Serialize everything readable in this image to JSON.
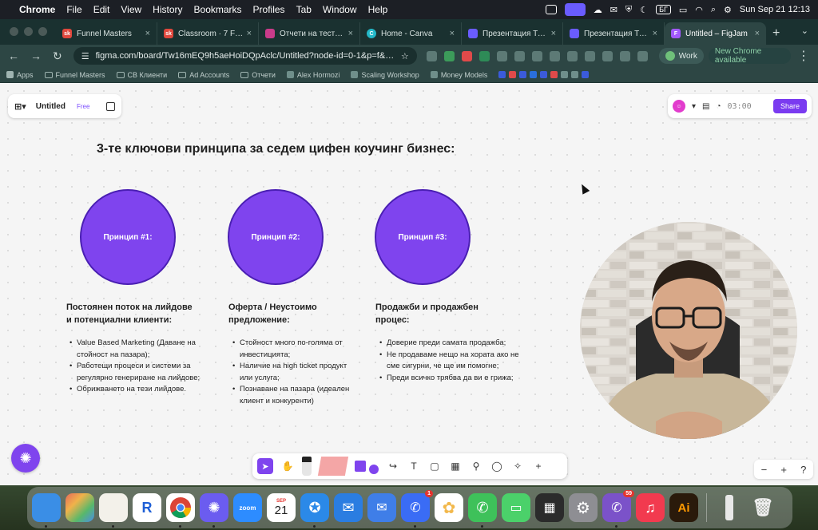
{
  "menubar": {
    "app": "Chrome",
    "items": [
      "File",
      "Edit",
      "View",
      "History",
      "Bookmarks",
      "Profiles",
      "Tab",
      "Window",
      "Help"
    ],
    "keyboard_layout": "БГ",
    "datetime": "Sun Sep 21  12:13"
  },
  "tabs": [
    {
      "title": "Funnel Masters",
      "fav_color": "#e0483d",
      "fav_text": "sk"
    },
    {
      "title": "Classroom · 7 Figure",
      "fav_color": "#e0483d",
      "fav_text": "sk"
    },
    {
      "title": "Отчети на теста: | T",
      "fav_color": "#c93b8a",
      "fav_text": ""
    },
    {
      "title": "Home - Canva",
      "fav_color": "#23b8c8",
      "fav_text": "C"
    },
    {
      "title": "Презентация Тайн",
      "fav_color": "#6a5cff",
      "fav_text": ""
    },
    {
      "title": "Презентация Тайн",
      "fav_color": "#6a5cff",
      "fav_text": ""
    },
    {
      "title": "Untitled – FigJam",
      "fav_color": "#a259ff",
      "fav_text": "F"
    }
  ],
  "omnibox": {
    "url": "figma.com/board/Tw16mEQ9h5aeHoiDQpAclc/Untitled?node-id=0-1&p=f&t=LwwA..."
  },
  "toolbar": {
    "profile": "Work",
    "update": "New Chrome available"
  },
  "bookmarks": [
    "Apps",
    "Funnel Masters",
    "СВ Клиенти",
    "Ad Accounts",
    "Отчети",
    "Alex Hormozi",
    "Scaling Workshop",
    "Money Models"
  ],
  "file": {
    "name": "Untitled",
    "plan": "Free"
  },
  "collab": {
    "timer": "03:00",
    "share": "Share"
  },
  "board": {
    "heading": "3-те ключови принципа за седем цифен коучинг бизнес:",
    "principles": [
      {
        "label": "Принцип #1:",
        "title": [
          "Постоянен поток на лийдове",
          "и потенциални клиенти:"
        ],
        "bullets": [
          "Value Based Marketing (Даване на стойност на пазара);",
          "Работещи процеси и системи за регулярно генериране на лийдове;",
          "Обрижването на тези лийдове."
        ]
      },
      {
        "label": "Принцип #2:",
        "title": [
          "Оферта / Неустоимо",
          "предложение:"
        ],
        "bullets": [
          "Стойност много по-голяма от инвестицията;",
          "Наличие на high ticket продукт или услуга;",
          "Познаване на пазара (идеален клиент и конкуренти)"
        ]
      },
      {
        "label": "Принцип #3:",
        "title": [
          "Продажби и продажбен",
          "процес:"
        ],
        "bullets": [
          "Доверие преди самата продажба;",
          "Не продаваме нещо на хората ако не сме сигурни, че ще им помогне;",
          "Преди всичко трябва да ви е грижа;"
        ]
      }
    ]
  },
  "dock": [
    {
      "name": "finder",
      "color": "#3a8ee6",
      "text": ""
    },
    {
      "name": "launchpad",
      "color": "#e66a5b",
      "text": ""
    },
    {
      "name": "notes",
      "color": "#f3f1ea",
      "text": ""
    },
    {
      "name": "rewind",
      "color": "#ffffff",
      "text": "R"
    },
    {
      "name": "chrome",
      "color": "#3aa35a",
      "text": ""
    },
    {
      "name": "chatgpt-app",
      "color": "#6b5cf0",
      "text": ""
    },
    {
      "name": "zoom",
      "color": "#2d8cff",
      "text": "zoom"
    },
    {
      "name": "calendar",
      "color": "#ffffff",
      "text": "21",
      "sub": "SEP"
    },
    {
      "name": "safari",
      "color": "#2b89e8",
      "text": ""
    },
    {
      "name": "mail",
      "color": "#2a7de1",
      "text": ""
    },
    {
      "name": "airmail",
      "color": "#3f7ee8",
      "text": ""
    },
    {
      "name": "messenger",
      "color": "#3a6cf5",
      "text": "",
      "badge": "1"
    },
    {
      "name": "photos",
      "color": "#f2b84b",
      "text": ""
    },
    {
      "name": "whatsapp",
      "color": "#3ec15a",
      "text": ""
    },
    {
      "name": "messages",
      "color": "#4bd16a",
      "text": ""
    },
    {
      "name": "calculator",
      "color": "#2b2b2b",
      "text": ""
    },
    {
      "name": "system-settings",
      "color": "#8e8e93",
      "text": ""
    },
    {
      "name": "viber",
      "color": "#7b52c9",
      "text": "",
      "badge": "59"
    },
    {
      "name": "music",
      "color": "#f23a4f",
      "text": ""
    },
    {
      "name": "illustrator",
      "color": "#2a1a0b",
      "text": "Ai"
    }
  ],
  "colors": {
    "accent": "#7f44ee",
    "circle_border": "#4a1fb3",
    "chrome_frame": "#2d4644"
  }
}
